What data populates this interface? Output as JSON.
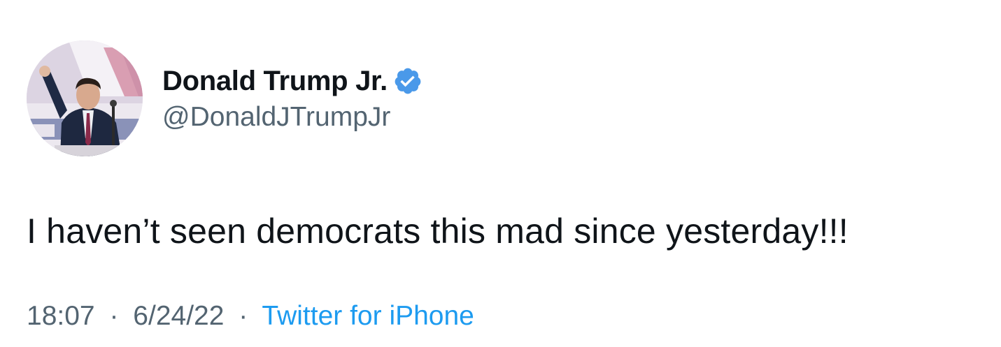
{
  "tweet": {
    "author": {
      "display_name": "Donald Trump Jr.",
      "handle": "@DonaldJTrumpJr",
      "verified": true,
      "verified_color": "#4a99e9",
      "avatar_icon": "profile-photo"
    },
    "text": "I haven’t seen democrats this mad since yesterday!!!",
    "time": "18:07",
    "separator": "·",
    "date": "6/24/22",
    "source": "Twitter for iPhone",
    "colors": {
      "text": "#0f1419",
      "secondary": "#536471",
      "link": "#1d9bf0"
    }
  }
}
